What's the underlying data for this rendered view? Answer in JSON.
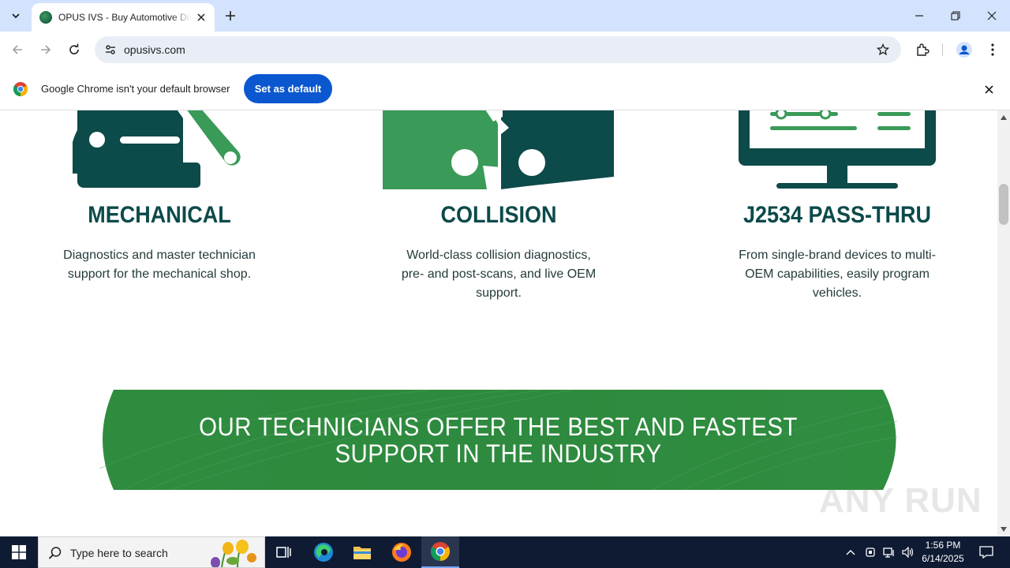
{
  "browser": {
    "tab": {
      "title": "OPUS IVS - Buy Automotive Diagnostic Tools"
    },
    "address": {
      "url": "opusivs.com"
    },
    "infobar": {
      "message": "Google Chrome isn't your default browser",
      "button_label": "Set as default"
    }
  },
  "features": [
    {
      "title": "MECHANICAL",
      "description": "Diagnostics and master technician support for the mechanical shop."
    },
    {
      "title": "COLLISION",
      "description": "World-class collision diagnostics, pre- and post-scans, and live OEM support."
    },
    {
      "title": "J2534 PASS-THRU",
      "description": "From single-brand devices to multi-OEM capabilities, easily program vehicles."
    }
  ],
  "banner": {
    "line1": "OUR TECHNICIANS OFFER THE BEST AND FASTEST",
    "line2": "SUPPORT IN THE INDUSTRY"
  },
  "watermark": "ANY RUN",
  "taskbar": {
    "search_placeholder": "Type here to search",
    "time": "1:56 PM",
    "date": "6/14/2025"
  },
  "colors": {
    "brand_dark": "#0d4a4a",
    "brand_green": "#3a9a58",
    "banner_green": "#2e8b3e",
    "chrome_blue": "#0b57d0"
  }
}
